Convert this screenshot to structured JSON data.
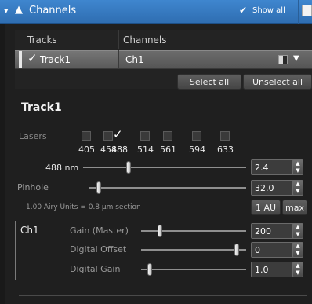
{
  "header": {
    "title": "Channels",
    "show_all_label": "Show all",
    "icons": [
      "collapse-arrow-icon",
      "channels-icon",
      "checkmark-icon",
      "document-icon"
    ]
  },
  "tracks_table": {
    "columns": [
      "Tracks",
      "Channels"
    ],
    "rows": [
      {
        "checked": true,
        "track": "Track1",
        "channel": "Ch1",
        "color_swatch": "black-white"
      }
    ]
  },
  "buttons": {
    "select_all": "Select all",
    "unselect_all": "Unselect all",
    "one_au": "1 AU",
    "max": "max"
  },
  "track_settings": {
    "title": "Track1",
    "lasers_label": "Lasers",
    "lasers": [
      {
        "wavelength": "405",
        "checked": false
      },
      {
        "wavelength": "458",
        "checked": false
      },
      {
        "wavelength": "488",
        "checked": true
      },
      {
        "wavelength": "514",
        "checked": false
      },
      {
        "wavelength": "561",
        "checked": false
      },
      {
        "wavelength": "594",
        "checked": false
      },
      {
        "wavelength": "633",
        "checked": false
      }
    ],
    "laser_488": {
      "label": "488 nm",
      "value": "2.4"
    },
    "pinhole": {
      "label": "Pinhole",
      "value": "32.0",
      "info": "1.00 Airy Units  =  0.8 µm section"
    },
    "channel": {
      "label": "Ch1",
      "gain_master": {
        "label": "Gain (Master)",
        "value": "200"
      },
      "digital_offset": {
        "label": "Digital Offset",
        "value": "0"
      },
      "digital_gain": {
        "label": "Digital Gain",
        "value": "1.0"
      }
    }
  },
  "colors": {
    "header_blue": "#2f6eb2",
    "panel_bg": "#1f1f1f",
    "row_selected": "#666666"
  }
}
